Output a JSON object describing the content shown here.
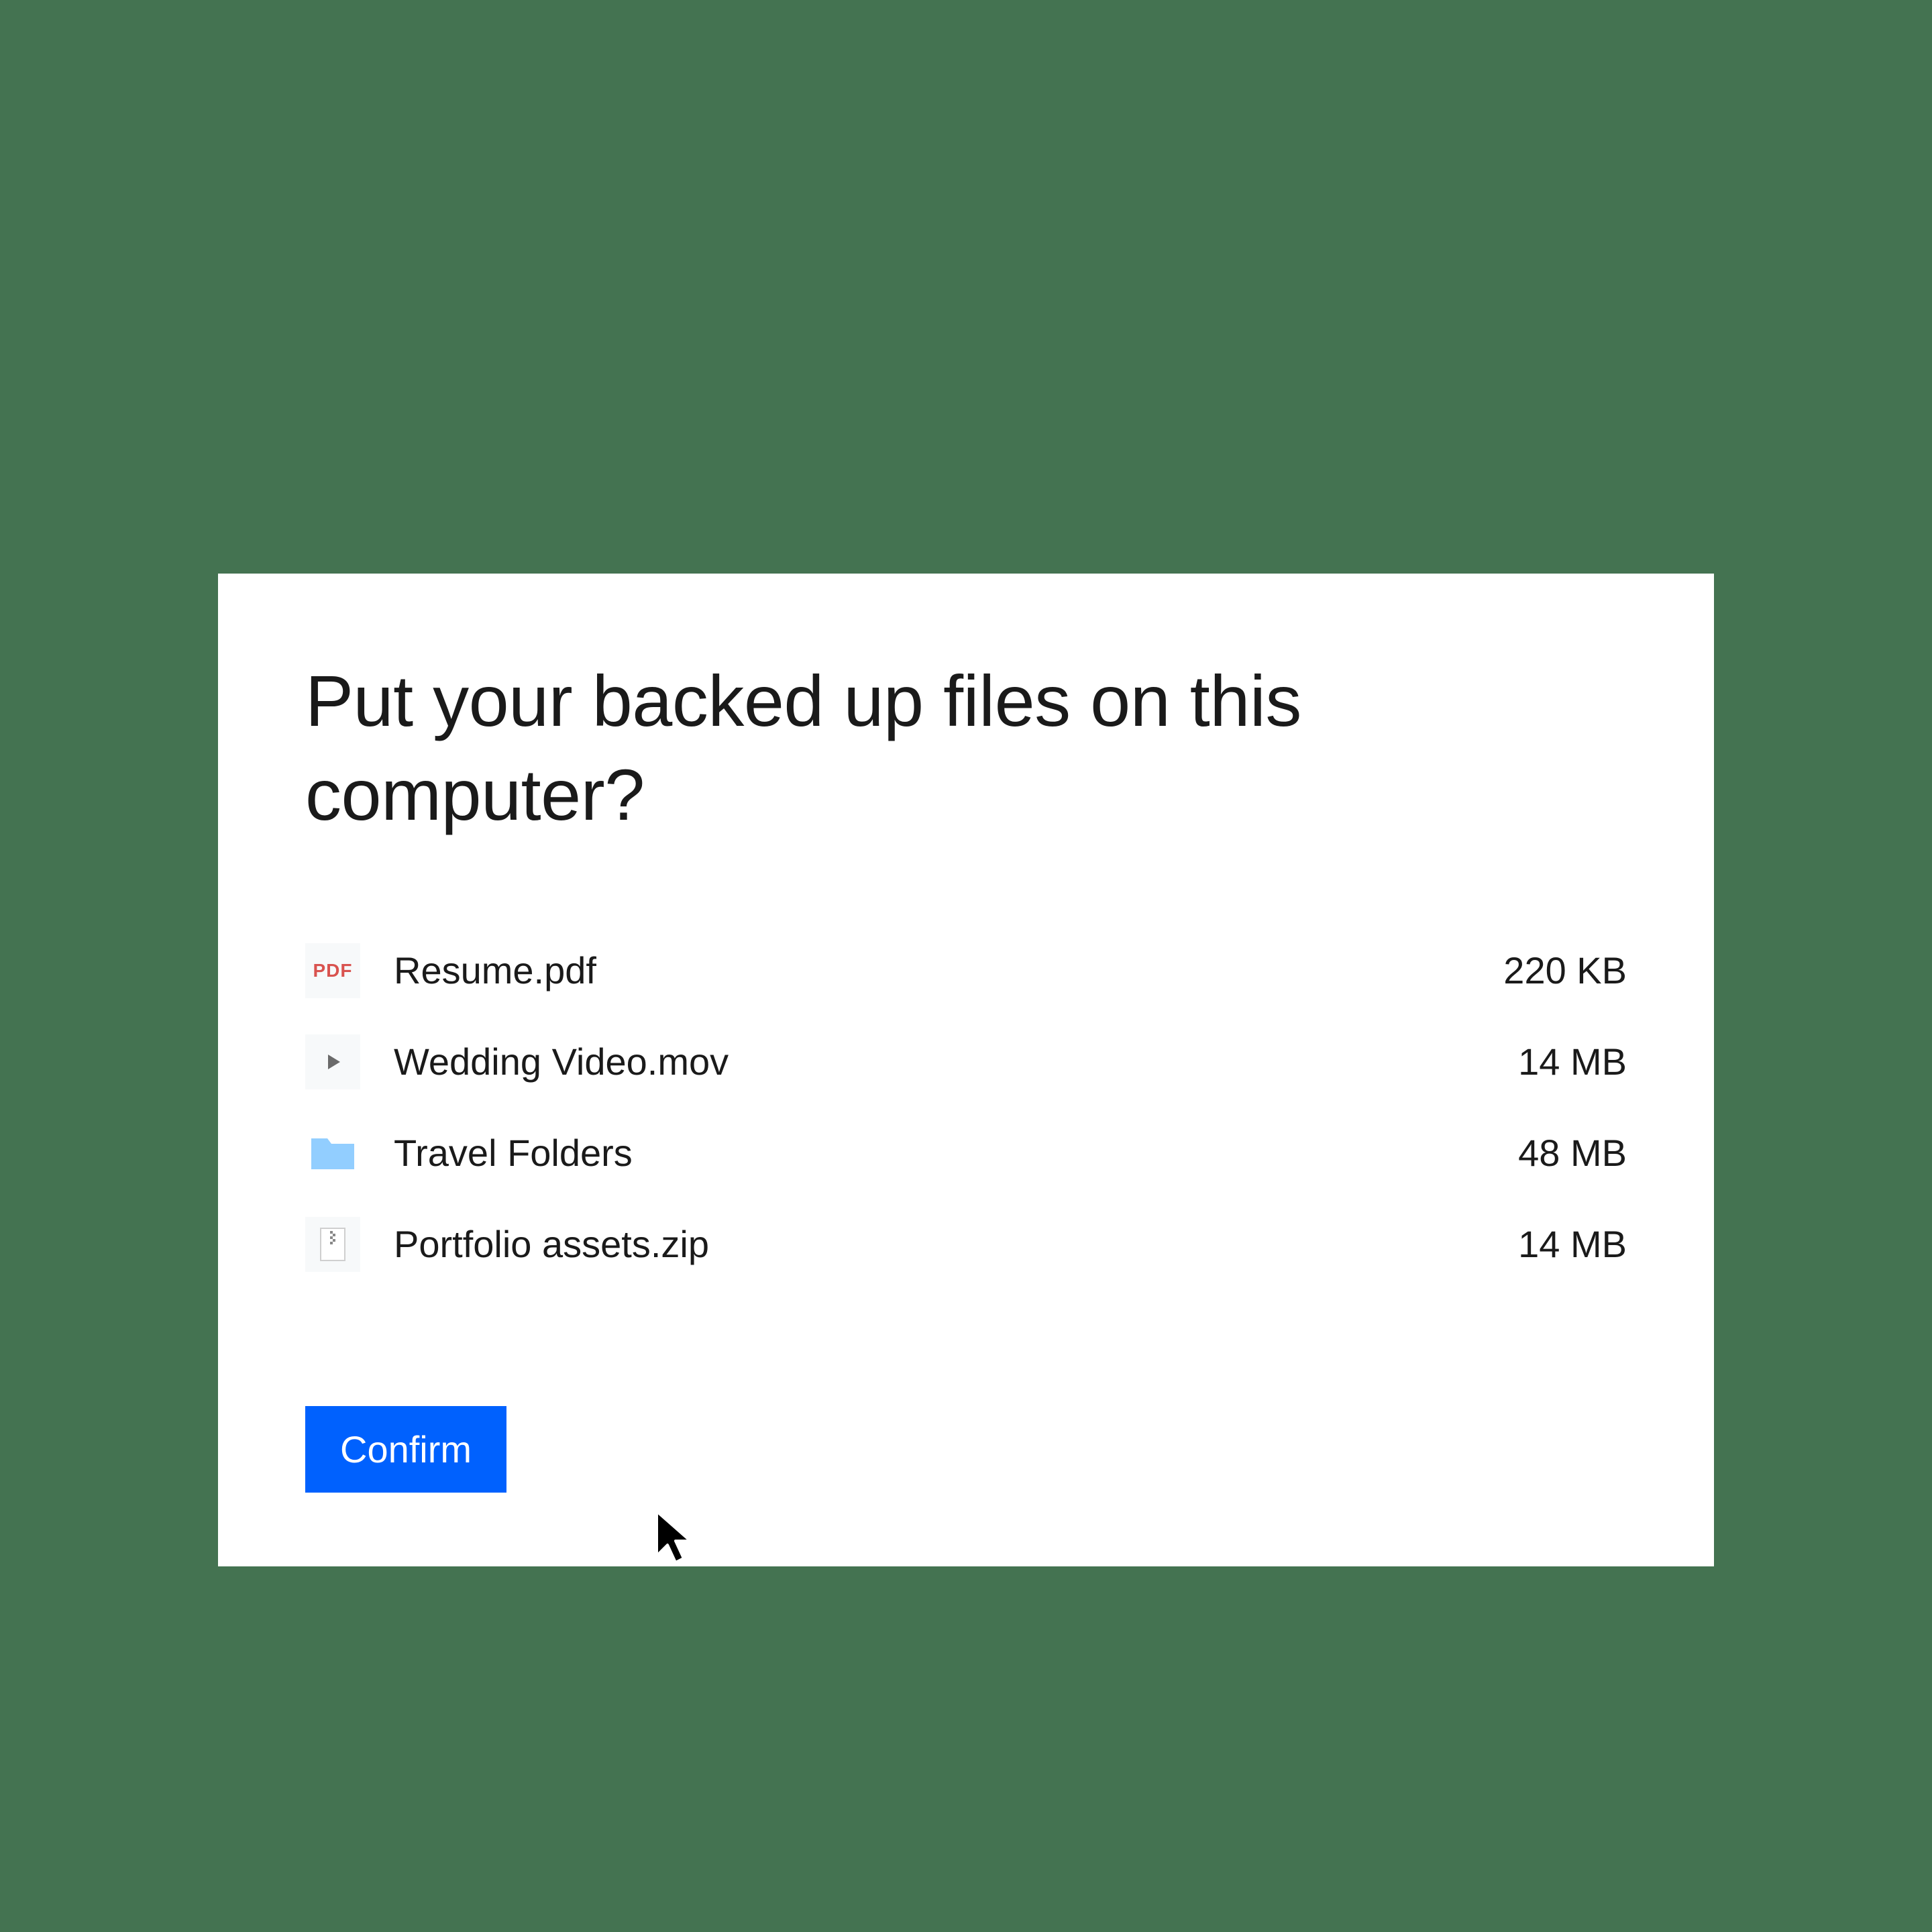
{
  "dialog": {
    "title": "Put your backed up files on this computer?",
    "files": [
      {
        "icon": "pdf",
        "name": "Resume.pdf",
        "size": "220 KB"
      },
      {
        "icon": "video",
        "name": "Wedding Video.mov",
        "size": "14 MB"
      },
      {
        "icon": "folder",
        "name": "Travel Folders",
        "size": "48 MB"
      },
      {
        "icon": "zip",
        "name": "Portfolio assets.zip",
        "size": "14 MB"
      }
    ],
    "confirm_label": "Confirm"
  },
  "icon_pdf_label": "PDF"
}
